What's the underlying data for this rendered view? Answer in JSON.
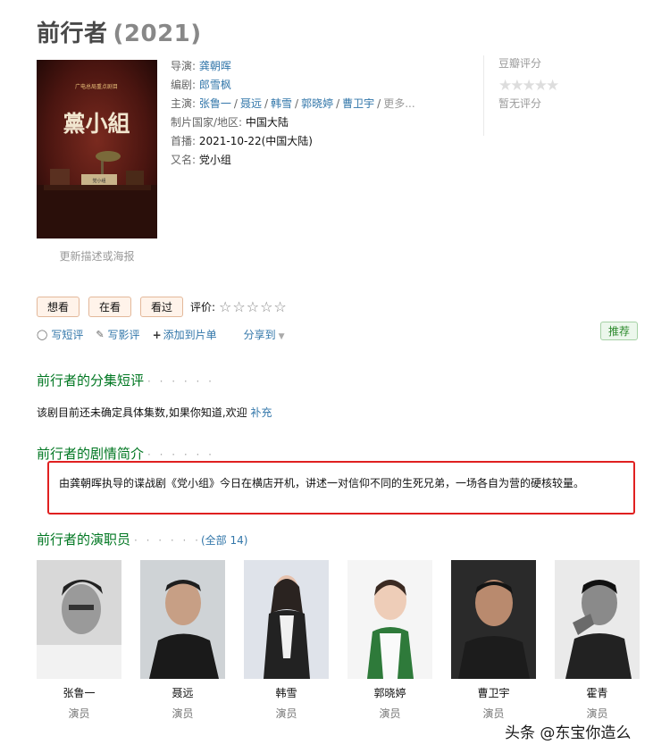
{
  "title": {
    "name": "前行者",
    "year": "(2021)"
  },
  "poster": {
    "header_text": "广电总局重点剧目",
    "title_text": "黨小組",
    "sub_text": "党小组"
  },
  "poster_link": "更新描述或海报",
  "info": {
    "director_label": "导演",
    "director": "龚朝晖",
    "writer_label": "编剧",
    "writer": "郎雪枫",
    "cast_label": "主演",
    "cast": [
      "张鲁一",
      "聂远",
      "韩雪",
      "郭晓婷",
      "曹卫宇"
    ],
    "cast_more": "更多...",
    "country_label": "制片国家/地区",
    "country": "中国大陆",
    "premiere_label": "首播",
    "premiere": "2021-10-22(中国大陆)",
    "aka_label": "又名",
    "aka": "党小组"
  },
  "rating": {
    "title": "豆瓣评分",
    "stars": "★★★★★",
    "none": "暂无评分"
  },
  "actions": {
    "want": "想看",
    "watching": "在看",
    "watched": "看过",
    "rate_label": "评价:",
    "rate_stars": "☆☆☆☆☆"
  },
  "sub_actions": {
    "short_review": "写短评",
    "review": "写影评",
    "add_list": "添加到片单",
    "share": "分享到"
  },
  "recommend": "推荐",
  "episodes": {
    "heading": "前行者的分集短评",
    "dots": "· · · · · ·",
    "note": "该剧目前还未确定具体集数,如果你知道,欢迎",
    "note_link": "补充"
  },
  "summary": {
    "heading": "前行者的剧情简介",
    "dots": "· · · · · ·",
    "text": "由龚朝晖执导的谍战剧《党小组》今日在横店开机，讲述一对信仰不同的生死兄弟，一场各自为营的硬核较量。"
  },
  "cast_section": {
    "heading": "前行者的演职员",
    "dots": "· · · · · ·",
    "paren_open": "(",
    "all_link": "全部 14",
    "paren_close": ")",
    "people": [
      {
        "name": "张鲁一",
        "role": "演员"
      },
      {
        "name": "聂远",
        "role": "演员"
      },
      {
        "name": "韩雪",
        "role": "演员"
      },
      {
        "name": "郭晓婷",
        "role": "演员"
      },
      {
        "name": "曹卫宇",
        "role": "演员"
      },
      {
        "name": "霍青",
        "role": "演员"
      }
    ]
  },
  "watermark": "头条 @东宝你造么"
}
